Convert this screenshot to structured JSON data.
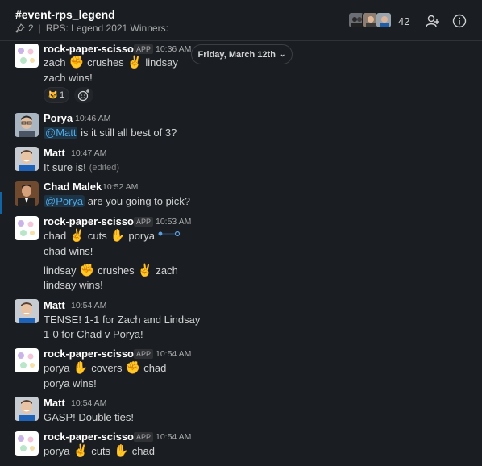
{
  "header": {
    "channel_name": "#event-rps_legend",
    "pinned_count": "2",
    "topic": "RPS: Legend 2021 Winners:",
    "member_count": "42"
  },
  "date_divider": {
    "label": "Friday, March 12th"
  },
  "messages": [
    {
      "author": "rock-paper-scissors",
      "is_app": true,
      "app_label": "APP",
      "time": "10:36 AM",
      "line1": {
        "a": "zach",
        "verb": "crushes",
        "b": "lindsay",
        "emoji_a": "✊",
        "emoji_b": "✌️"
      },
      "line2": "zach wins!",
      "reaction": {
        "emoji": "🐱",
        "count": "1"
      }
    },
    {
      "author": "Porya",
      "time": "10:46 AM",
      "mention": "@Matt",
      "text": " is it still all best of 3?"
    },
    {
      "author": "Matt",
      "time": "10:47 AM",
      "text": "It sure is!",
      "edited": "(edited)"
    },
    {
      "author": "Chad Malek",
      "time": "10:52 AM",
      "mention": "@Porya",
      "text": " are you going to pick?"
    },
    {
      "author": "rock-paper-scissors",
      "is_app": true,
      "app_label": "APP",
      "time": "10:53 AM",
      "line1": {
        "a": "chad",
        "verb": "cuts",
        "b": "porya",
        "emoji_a": "✌️",
        "emoji_b": "✋"
      },
      "line2": "chad wins!",
      "line3": {
        "a": "lindsay",
        "verb": "crushes",
        "b": "zach",
        "emoji_a": "✊",
        "emoji_b": "✌️"
      },
      "line4": "lindsay wins!"
    },
    {
      "author": "Matt",
      "time": "10:54 AM",
      "text1": "TENSE! 1-1 for Zach and Lindsay",
      "text2": "1-0 for Chad v Porya!"
    },
    {
      "author": "rock-paper-scissors",
      "is_app": true,
      "app_label": "APP",
      "time": "10:54 AM",
      "line1": {
        "a": "porya",
        "verb": "covers",
        "b": "chad",
        "emoji_a": "✋",
        "emoji_b": "✊"
      },
      "line2": "porya wins!"
    },
    {
      "author": "Matt",
      "time": "10:54 AM",
      "text": "GASP! Double ties!"
    },
    {
      "author": "rock-paper-scissors",
      "is_app": true,
      "app_label": "APP",
      "time": "10:54 AM",
      "line1": {
        "a": "porya",
        "verb": "cuts",
        "b": "chad",
        "emoji_a": "✌️",
        "emoji_b": "✋"
      }
    }
  ],
  "colors": {
    "background": "#1a1d21",
    "mention_bg": "#1d3346",
    "mention_text": "#4fa7e0",
    "accent": "#1264a3"
  }
}
